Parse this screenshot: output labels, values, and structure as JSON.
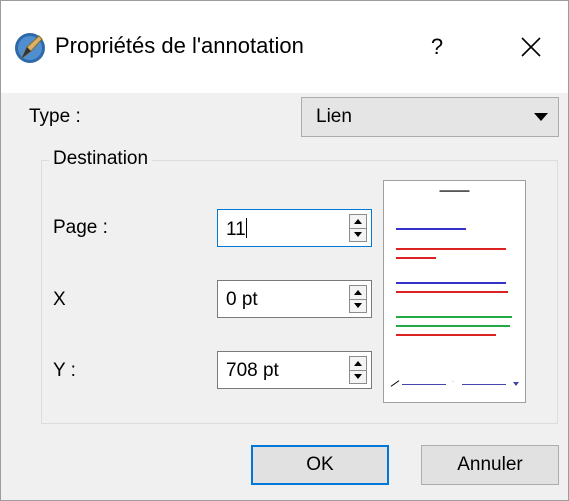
{
  "window": {
    "title": "Propriétés de l'annotation",
    "help_label": "?"
  },
  "type_field": {
    "label": "Type :",
    "selected": "Lien"
  },
  "destination": {
    "group_label": "Destination",
    "page": {
      "label": "Page :",
      "value": "11"
    },
    "x": {
      "label": "X",
      "value": "0 pt"
    },
    "y": {
      "label": "Y :",
      "value": "708 pt"
    }
  },
  "preview": {
    "icon": "page-thumbnail-icon",
    "line_colors": [
      "#3333cc",
      "#dd2222",
      "#22aa44"
    ]
  },
  "buttons": {
    "ok": "OK",
    "cancel": "Annuler"
  },
  "colors": {
    "accent": "#0078d7",
    "dialog_bg": "#f0f0f0"
  }
}
